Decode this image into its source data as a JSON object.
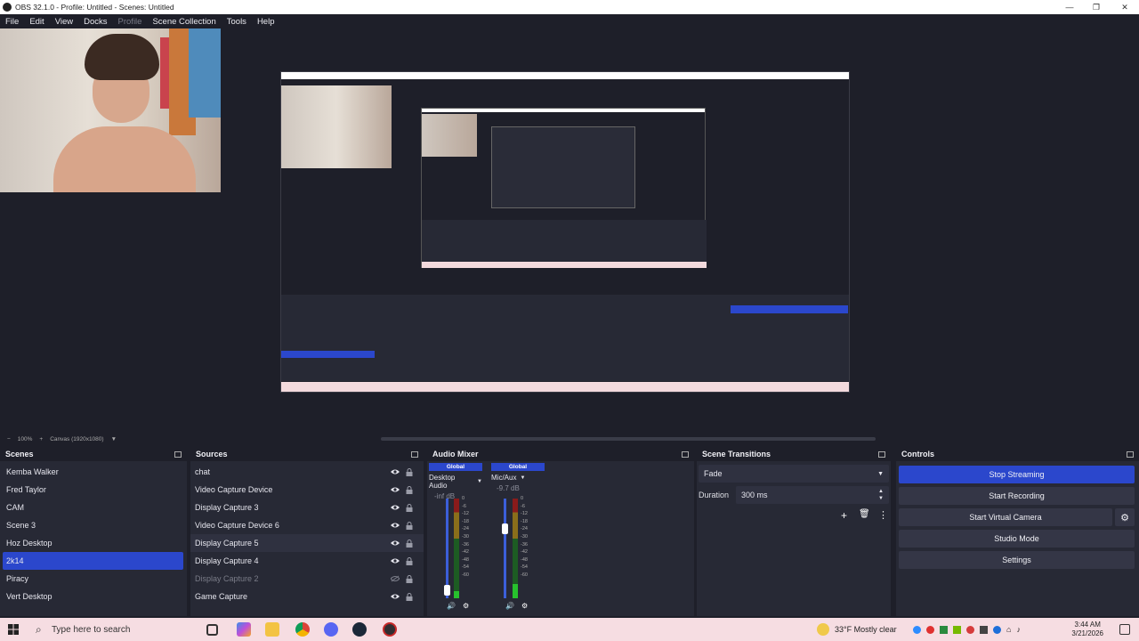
{
  "window": {
    "title": "OBS 32.1.0 - Profile: Untitled - Scenes: Untitled"
  },
  "menu": [
    {
      "label": "File",
      "disabled": false
    },
    {
      "label": "Edit",
      "disabled": false
    },
    {
      "label": "View",
      "disabled": false
    },
    {
      "label": "Docks",
      "disabled": false
    },
    {
      "label": "Profile",
      "disabled": true
    },
    {
      "label": "Scene Collection",
      "disabled": false
    },
    {
      "label": "Tools",
      "disabled": false
    },
    {
      "label": "Help",
      "disabled": false
    }
  ],
  "status": {
    "zoom_minus": "−",
    "zoom": "100%",
    "zoom_plus": "+",
    "canvas": "Canvas (1920x1080)"
  },
  "scenes": {
    "title": "Scenes",
    "items": [
      "Kemba Walker",
      "Fred Taylor",
      "CAM",
      "Scene 3",
      "Hoz Desktop",
      "2k14",
      "Piracy",
      "Vert Desktop"
    ],
    "selected_index": 5
  },
  "sources": {
    "title": "Sources",
    "items": [
      {
        "name": "chat",
        "visible": true
      },
      {
        "name": "Video Capture Device",
        "visible": true
      },
      {
        "name": "Display Capture 3",
        "visible": true
      },
      {
        "name": "Video Capture Device 6",
        "visible": true
      },
      {
        "name": "Display Capture 5",
        "visible": true
      },
      {
        "name": "Display Capture 4",
        "visible": true
      },
      {
        "name": "Display Capture 2",
        "visible": false
      },
      {
        "name": "Game Capture",
        "visible": true
      }
    ]
  },
  "mixer": {
    "title": "Audio Mixer",
    "channels": [
      {
        "global": "Global",
        "name": "Desktop Audio",
        "db": "-inf dB",
        "level": 0.07,
        "fader": 0.08
      },
      {
        "global": "Global",
        "name": "Mic/Aux",
        "db": "-9.7 dB",
        "level": 0.14,
        "fader": 0.7
      }
    ],
    "scale": [
      "0",
      "-6",
      "-12",
      "-18",
      "-24",
      "-30",
      "-36",
      "-42",
      "-48",
      "-54",
      "-60"
    ]
  },
  "transitions": {
    "title": "Scene Transitions",
    "selected": "Fade",
    "duration_label": "Duration",
    "duration_value": "300 ms"
  },
  "controls": {
    "title": "Controls",
    "buttons": [
      "Stop Streaming",
      "Start Recording",
      "Start Virtual Camera",
      "Studio Mode",
      "Settings"
    ]
  },
  "taskbar": {
    "search_placeholder": "Type here to search",
    "weather": "33°F  Mostly clear",
    "time": "3:44 AM",
    "date": "3/21/2026"
  },
  "colors": {
    "accent": "#2b47cc",
    "panel": "#272935",
    "background": "#1e1f29",
    "taskbar": "#f6dde2"
  }
}
